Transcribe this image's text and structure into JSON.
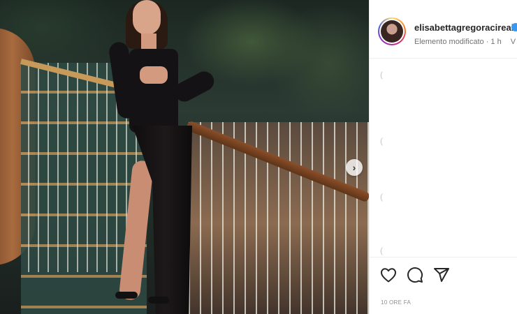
{
  "post": {
    "media_alt_icon": "photo",
    "carousel_next_icon": "chevron-right-icon",
    "carousel_next_glyph": "›"
  },
  "header": {
    "username": "elisabettagregoracireal",
    "verified_icon": "verified-badge-icon",
    "subtitle": "Elemento modificato · 1 h",
    "subtitle_more": "V"
  },
  "comments_placeholders": [
    "(",
    "(",
    "(",
    "("
  ],
  "actions": {
    "like_icon": "heart-icon",
    "comment_icon": "comment-icon",
    "share_icon": "share-icon"
  },
  "timestamp": "10 ORE FA",
  "colors": {
    "accent_verified": "#3897f0",
    "text_primary": "#262626",
    "text_secondary": "#737373"
  }
}
